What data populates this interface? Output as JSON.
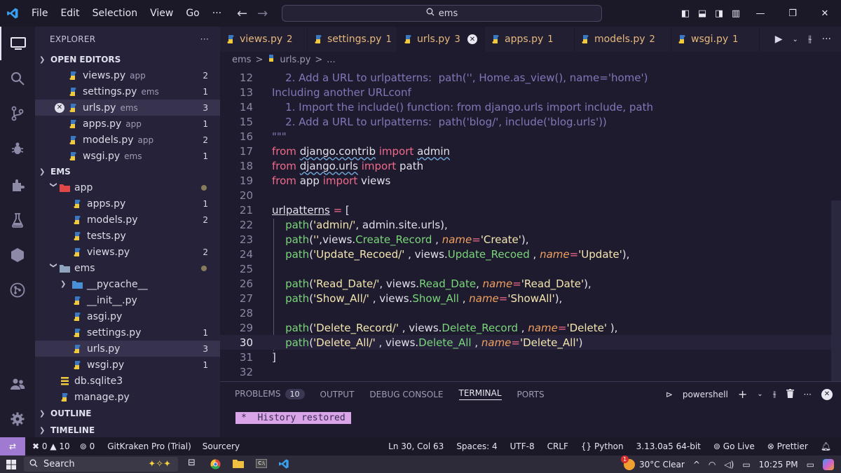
{
  "titlebar": {
    "menu": [
      "File",
      "Edit",
      "Selection",
      "View",
      "Go"
    ],
    "more": "···",
    "search": "ems"
  },
  "sidebar": {
    "title": "EXPLORER",
    "more": "···",
    "open_editors_label": "OPEN EDITORS",
    "open_editors": [
      {
        "name": "views.py",
        "desc": "app",
        "badge": "2",
        "selected": false,
        "close": false
      },
      {
        "name": "settings.py",
        "desc": "ems",
        "badge": "1",
        "selected": false,
        "close": false
      },
      {
        "name": "urls.py",
        "desc": "ems",
        "badge": "3",
        "selected": true,
        "close": true
      },
      {
        "name": "apps.py",
        "desc": "app",
        "badge": "1",
        "selected": false,
        "close": false
      },
      {
        "name": "models.py",
        "desc": "app",
        "badge": "2",
        "selected": false,
        "close": false
      },
      {
        "name": "wsgi.py",
        "desc": "ems",
        "badge": "1",
        "selected": false,
        "close": false
      }
    ],
    "ems_label": "EMS",
    "tree": [
      {
        "name": "app",
        "type": "folder",
        "level": 1,
        "badge": "",
        "dot": true
      },
      {
        "name": "apps.py",
        "type": "py",
        "level": 2,
        "badge": "1"
      },
      {
        "name": "models.py",
        "type": "py",
        "level": 2,
        "badge": "2"
      },
      {
        "name": "tests.py",
        "type": "py",
        "level": 2,
        "badge": ""
      },
      {
        "name": "views.py",
        "type": "py",
        "level": 2,
        "badge": "2"
      },
      {
        "name": "ems",
        "type": "folder",
        "level": 1,
        "badge": "",
        "dot": true
      },
      {
        "name": "__pycache__",
        "type": "folder-closed",
        "level": 2,
        "badge": ""
      },
      {
        "name": "__init__.py",
        "type": "py",
        "level": 2,
        "badge": ""
      },
      {
        "name": "asgi.py",
        "type": "py",
        "level": 2,
        "badge": ""
      },
      {
        "name": "settings.py",
        "type": "py",
        "level": 2,
        "badge": "1"
      },
      {
        "name": "urls.py",
        "type": "py",
        "level": 2,
        "badge": "3",
        "selected": true
      },
      {
        "name": "wsgi.py",
        "type": "py",
        "level": 2,
        "badge": "1"
      },
      {
        "name": "db.sqlite3",
        "type": "db",
        "level": 1,
        "badge": ""
      },
      {
        "name": "manage.py",
        "type": "py",
        "level": 1,
        "badge": ""
      }
    ],
    "outline_label": "OUTLINE",
    "timeline_label": "TIMELINE"
  },
  "tabs": [
    {
      "name": "views.py",
      "count": "2",
      "active": false
    },
    {
      "name": "settings.py",
      "count": "1",
      "active": false
    },
    {
      "name": "urls.py",
      "count": "3",
      "active": true
    },
    {
      "name": "apps.py",
      "count": "1",
      "active": false
    },
    {
      "name": "models.py",
      "count": "2",
      "active": false
    },
    {
      "name": "wsgi.py",
      "count": "1",
      "active": false
    }
  ],
  "breadcrumb": {
    "folder": "ems",
    "sep": ">",
    "file": "urls.py",
    "more": "..."
  },
  "editor": {
    "lines": [
      {
        "n": "12",
        "html": "<span class='c'>    2. Add a URL to urlpatterns:  path('', Home.as_view(), name='home')</span>"
      },
      {
        "n": "13",
        "html": "<span class='c'>Including another URLconf</span>"
      },
      {
        "n": "14",
        "html": "<span class='c'>    1. Import the include() function: from django.urls import include, path</span>"
      },
      {
        "n": "15",
        "html": "<span class='c'>    2. Add a URL to urlpatterns:  path('blog/', include('blog.urls'))</span>"
      },
      {
        "n": "16",
        "html": "<span class='c'>\"\"\"</span>"
      },
      {
        "n": "17",
        "html": "<span class='kw'>from</span> <span class='wavy'>django.contrib</span> <span class='kw'>import</span> <span class='wavy'>admin</span>"
      },
      {
        "n": "18",
        "html": "<span class='kw'>from</span> <span class='wavy'>django.urls</span> <span class='kw'>import</span> path"
      },
      {
        "n": "19",
        "html": "<span class='kw'>from</span> app <span class='kw'>import</span> views"
      },
      {
        "n": "20",
        "html": ""
      },
      {
        "n": "21",
        "html": "<span class='var'>urlpatterns</span> <span class='op'>=</span> ["
      },
      {
        "n": "22",
        "html": "    <span class='fn'>path</span>(<span class='str'>'admin/'</span>, admin.site.urls),"
      },
      {
        "n": "23",
        "html": "    <span class='fn'>path</span>(<span class='str'>''</span>,views.<span class='fn'>Create_Record</span> , <span class='par'>name</span><span class='op'>=</span><span class='str'>'Create'</span>),"
      },
      {
        "n": "24",
        "html": "    <span class='fn'>path</span>(<span class='str'>'Update_Recoed/'</span> , views.<span class='fn'>Update_Recoed</span> , <span class='par'>name</span><span class='op'>=</span><span class='str'>'Update'</span>),"
      },
      {
        "n": "25",
        "html": ""
      },
      {
        "n": "26",
        "html": "    <span class='fn'>path</span>(<span class='str'>'Read_Date/'</span>, views.<span class='fn'>Read_Date</span>, <span class='par'>name</span><span class='op'>=</span><span class='str'>'Read_Date'</span>),"
      },
      {
        "n": "27",
        "html": "    <span class='fn'>path</span>(<span class='str'>'Show_All/'</span> , views.<span class='fn'>Show_All</span> , <span class='par'>name</span><span class='op'>=</span><span class='str'>'ShowAll'</span>),"
      },
      {
        "n": "28",
        "html": ""
      },
      {
        "n": "29",
        "html": "    <span class='fn'>path</span>(<span class='str'>'Delete_Record/'</span> , views.<span class='fn'>Delete_Record</span> , <span class='par'>name</span><span class='op'>=</span><span class='str'>'Delete'</span> ),"
      },
      {
        "n": "30",
        "html": "    <span class='fn'>path</span>(<span class='str'>'Delete_All/'</span> , views.<span class='fn'>Delete_All</span> , <span class='par'>name</span><span class='op'>=</span><span class='str'>'Delete_All'</span>)",
        "cur": true
      },
      {
        "n": "31",
        "html": "]"
      },
      {
        "n": "32",
        "html": ""
      }
    ]
  },
  "panel": {
    "tabs": [
      {
        "label": "PROBLEMS",
        "badge": "10",
        "active": false
      },
      {
        "label": "OUTPUT",
        "badge": "",
        "active": false
      },
      {
        "label": "DEBUG CONSOLE",
        "badge": "",
        "active": false
      },
      {
        "label": "TERMINAL",
        "badge": "",
        "active": true
      },
      {
        "label": "PORTS",
        "badge": "",
        "active": false
      }
    ],
    "shell": "powershell",
    "terminal_prefix": "*",
    "terminal_text": "History restored"
  },
  "status": {
    "errors": "0",
    "warnings": "10",
    "ports": "0",
    "gitkraken": "GitKraken Pro (Trial)",
    "sourcery": "Sourcery",
    "position": "Ln 30, Col 63",
    "spaces": "Spaces: 4",
    "encoding": "UTF-8",
    "eol": "CRLF",
    "language": "Python",
    "version": "3.13.0a5 64-bit",
    "golive": "Go Live",
    "prettier": "Prettier"
  },
  "taskbar": {
    "search": "Search",
    "weather_badge": "1",
    "weather": "30°C  Clear",
    "time": "10:25 PM"
  },
  "colors": {
    "accent": "#a07ad0",
    "bg": "#1e1b2e",
    "sidebar": "#25223a"
  }
}
